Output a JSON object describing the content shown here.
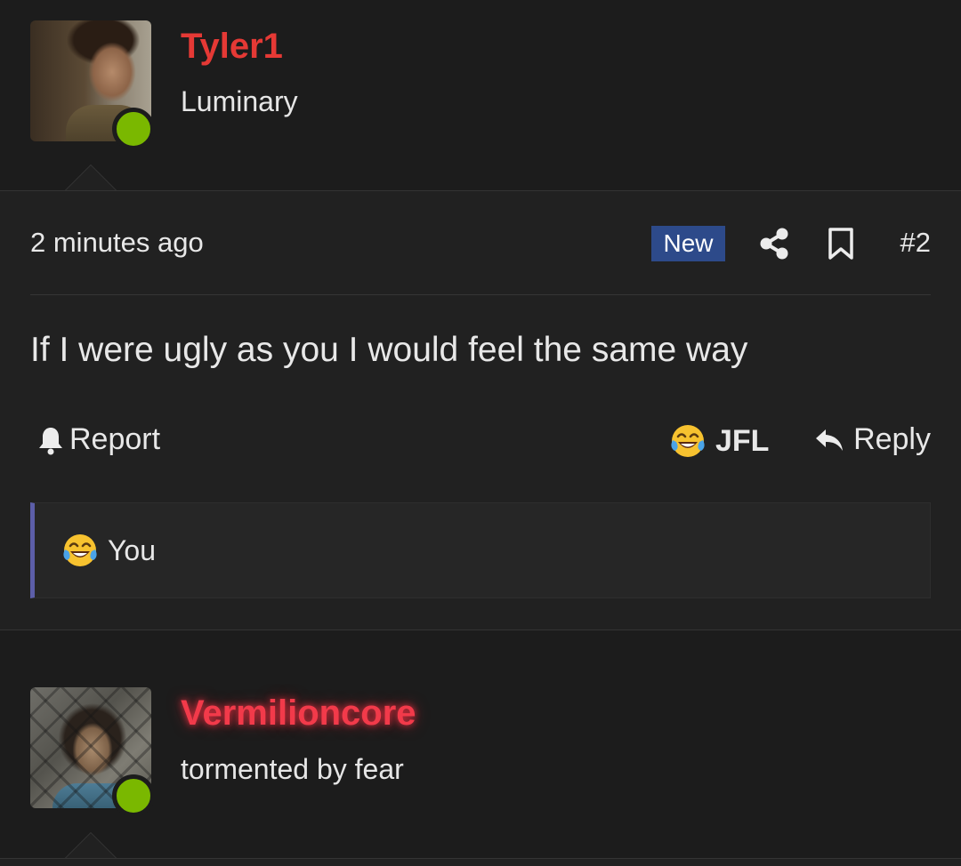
{
  "posts": [
    {
      "author": {
        "name": "Tyler1",
        "title": "Luminary",
        "online": true
      },
      "time": "2 minutes ago",
      "badge": "New",
      "number": "#2",
      "message": "If I were ugly as you I would feel the same way",
      "actions": {
        "report": "Report",
        "reaction": "JFL",
        "reply": "Reply"
      },
      "reactions_summary": {
        "emoji": "laughing-crying-face",
        "text": "You"
      }
    },
    {
      "author": {
        "name": "Vermilioncore",
        "title": "tormented by fear",
        "online": true
      }
    }
  ],
  "colors": {
    "background": "#1c1c1c",
    "post_body": "#212121",
    "username_red": "#e53935",
    "new_badge": "#2d4a8a",
    "online_green": "#7ab800",
    "reaction_accent": "#5c5ea8"
  }
}
